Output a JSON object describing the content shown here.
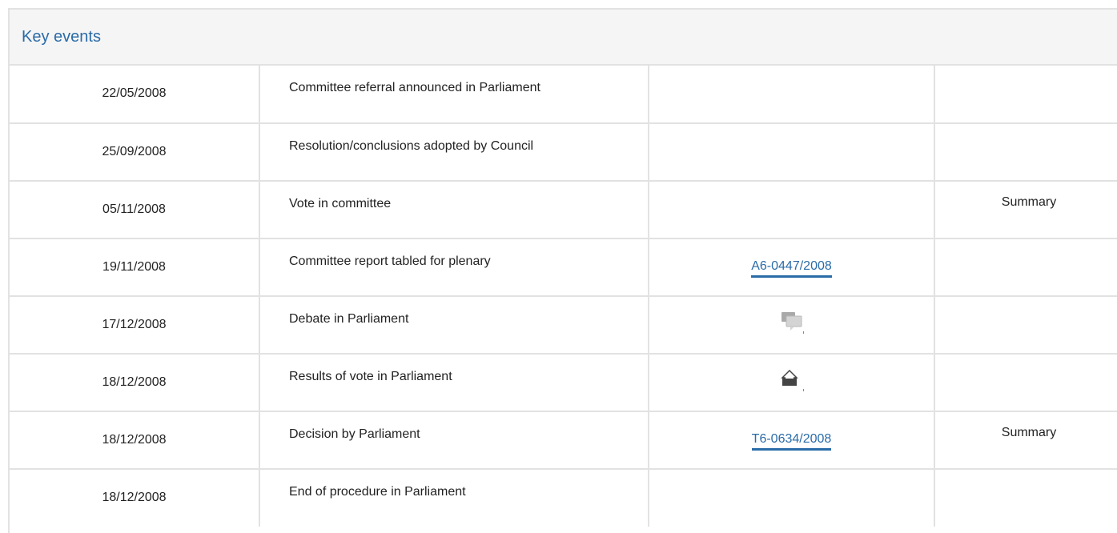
{
  "panel": {
    "title": "Key events"
  },
  "events": [
    {
      "date": "22/05/2008",
      "event": "Committee referral announced in Parliament",
      "document": "",
      "summary": ""
    },
    {
      "date": "25/09/2008",
      "event": "Resolution/conclusions adopted by Council",
      "document": "",
      "summary": ""
    },
    {
      "date": "05/11/2008",
      "event": "Vote in committee",
      "document": "",
      "summary": "Summary"
    },
    {
      "date": "19/11/2008",
      "event": "Committee report tabled for plenary",
      "document": "A6-0447/2008",
      "summary": ""
    },
    {
      "date": "17/12/2008",
      "event": "Debate in Parliament",
      "document": "",
      "document_icon": "debate-icon",
      "summary": ""
    },
    {
      "date": "18/12/2008",
      "event": "Results of vote in Parliament",
      "document": "",
      "document_icon": "vote-results-icon",
      "summary": ""
    },
    {
      "date": "18/12/2008",
      "event": "Decision by Parliament",
      "document": "T6-0634/2008",
      "summary": "Summary"
    },
    {
      "date": "18/12/2008",
      "event": "End of procedure in Parliament",
      "document": "",
      "summary": ""
    }
  ],
  "colors": {
    "link": "#2a6ba8",
    "header_bg": "#f5f5f5",
    "border": "#e2e2e2"
  }
}
